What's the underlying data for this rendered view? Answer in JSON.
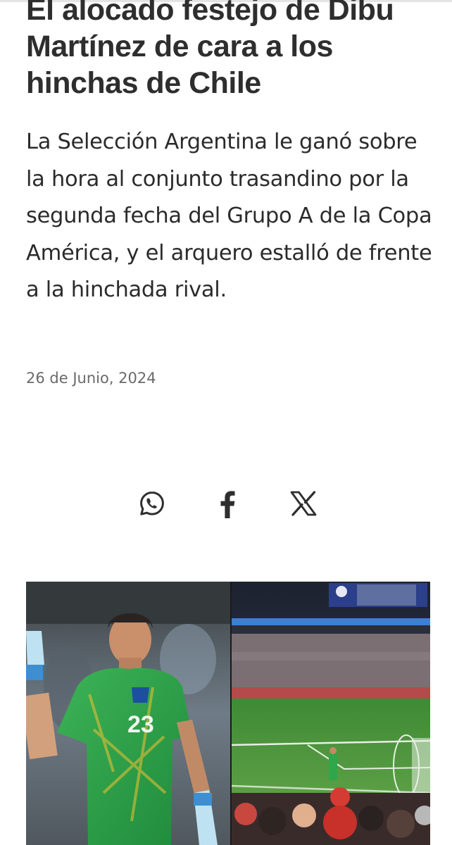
{
  "article": {
    "headline": "El alocado festejo de Dibu Martínez de cara a los hinchas de Chile",
    "summary": "La Selección Argentina le ganó sobre la hora al conjunto trasandino por la segunda fecha del Grupo A de la Copa América, y el arquero estalló de frente a la hinchada rival.",
    "date": "26 de Junio, 2024"
  },
  "share": [
    {
      "icon": "whatsapp-icon"
    },
    {
      "icon": "facebook-icon"
    },
    {
      "icon": "x-icon"
    }
  ],
  "photo": {
    "jersey_number": "23"
  },
  "colors": {
    "text": "#2b2b2b",
    "meta": "#6a6a6a",
    "jersey": "#2fa64a",
    "pitch": "#4a8f3a"
  }
}
